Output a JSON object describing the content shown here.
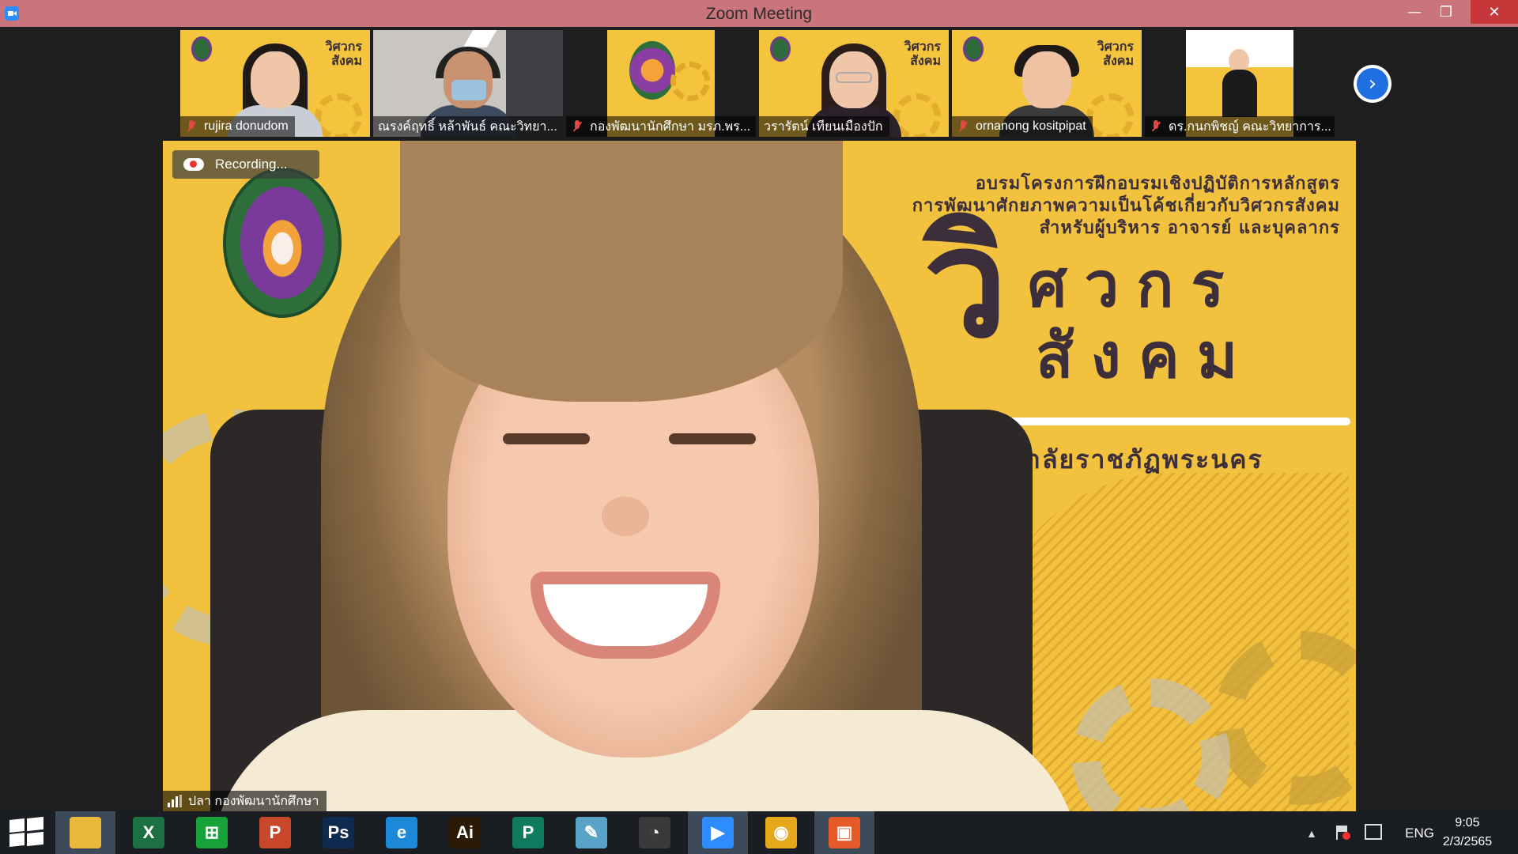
{
  "window": {
    "title": "Zoom Meeting",
    "controls": {
      "minimize": "—",
      "restore": "❐",
      "close": "✕"
    }
  },
  "participants": [
    {
      "name": "rujira donudom",
      "muted": true
    },
    {
      "name": "ณรงค์ฤทธิ์ หล้าพันธ์ คณะวิทยา...",
      "muted": false
    },
    {
      "name": "กองพัฒนานักศึกษา มรภ.พร...",
      "muted": true
    },
    {
      "name": "วรารัตน์ เทียนเมืองปัก",
      "muted": false
    },
    {
      "name": "ornanong kositpipat",
      "muted": true
    },
    {
      "name": "ดร.กนกพิชญ์ คณะวิทยาการ...",
      "muted": true
    }
  ],
  "next_page_icon": "chevron-right-icon",
  "recording_label": "Recording...",
  "active_speaker": "ปลา กองพัฒนานักศึกษา",
  "poster": {
    "line1": "อบรมโครงการฝึกอบรมเชิงปฏิบัติการหลักสูตร",
    "line2": "การพัฒนาศักยภาพความเป็นโค้ชเกี่ยวกับวิศวกรสังคม",
    "line3": "สำหรับผู้บริหาร อาจารย์ และบุคลากร",
    "big_v": "วิ",
    "word1": "ศวกร",
    "word2": "สังคม",
    "university": "มหาวิทยาลัยราชภัฏพระนคร",
    "thumb_v": "วิศวกร",
    "thumb_w": "สังคม"
  },
  "taskbar": {
    "apps": [
      {
        "name": "file-explorer",
        "glyph": "",
        "color": "#e8b83a",
        "active": true
      },
      {
        "name": "excel",
        "glyph": "X",
        "color": "#1d7044",
        "active": false
      },
      {
        "name": "store",
        "glyph": "⊞",
        "color": "#18a33a",
        "active": false
      },
      {
        "name": "powerpoint",
        "glyph": "P",
        "color": "#c9472a",
        "active": false
      },
      {
        "name": "photoshop",
        "glyph": "Ps",
        "color": "#0f2a4f",
        "active": false
      },
      {
        "name": "internet-explorer",
        "glyph": "e",
        "color": "#1c88d8",
        "active": false
      },
      {
        "name": "illustrator",
        "glyph": "Ai",
        "color": "#2b1a05",
        "active": false
      },
      {
        "name": "publisher",
        "glyph": "P",
        "color": "#0e7a5e",
        "active": false
      },
      {
        "name": "notepad",
        "glyph": "✎",
        "color": "#5aa3c8",
        "active": false
      },
      {
        "name": "photoscape",
        "glyph": "◔",
        "color": "#3a3a3a",
        "active": false
      },
      {
        "name": "zoom",
        "glyph": "▶",
        "color": "#2d8cff",
        "active": true
      },
      {
        "name": "chrome",
        "glyph": "◉",
        "color": "#e4a81a",
        "active": false
      },
      {
        "name": "paint",
        "glyph": "▣",
        "color": "#e65a2a",
        "active": true
      }
    ],
    "language": "ENG",
    "time": "9:05",
    "date": "2/3/2565"
  }
}
